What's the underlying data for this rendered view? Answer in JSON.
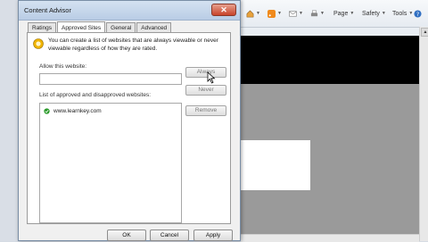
{
  "dialog": {
    "title": "Content Advisor",
    "close_glyph": "✕",
    "tabs": [
      "Ratings",
      "Approved Sites",
      "General",
      "Advanced"
    ],
    "active_tab": 1,
    "info_text": "You can create a list of websites that are always viewable or never viewable regardless of how they are rated.",
    "allow_label": "Allow this website:",
    "allow_value": "",
    "always_button": "Always",
    "never_button": "Never",
    "list_label": "List of approved and disapproved websites:",
    "list_items": [
      {
        "site": "www.learnkey.com",
        "status": "approved",
        "status_color": "#2a9a2a"
      }
    ],
    "remove_button": "Remove",
    "ok_button": "OK",
    "cancel_button": "Cancel",
    "apply_button": "Apply"
  },
  "browser_toolbar": {
    "page_label": "Page",
    "safety_label": "Safety",
    "tools_label": "Tools",
    "icons": [
      "home-icon",
      "feeds-icon",
      "mail-icon",
      "print-icon",
      "help-icon"
    ]
  },
  "colors": {
    "title_bar": "#c6d7ea",
    "close_button": "#c8432a",
    "accent_icon": "#f0b400"
  }
}
